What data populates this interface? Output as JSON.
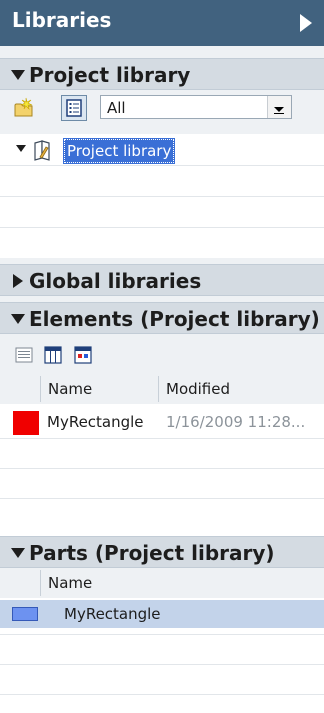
{
  "panel": {
    "title": "Libraries"
  },
  "project_library": {
    "header": "Project library",
    "filter": {
      "value": "All"
    },
    "tree": [
      {
        "label": "Project library",
        "selected": true
      }
    ]
  },
  "global_libraries": {
    "header": "Global libraries"
  },
  "elements": {
    "header": "Elements (Project library)",
    "columns": [
      "Name",
      "Modified"
    ],
    "rows": [
      {
        "name": "MyRectangle",
        "modified": "1/16/2009 11:28...",
        "color": "#f00000"
      }
    ]
  },
  "parts": {
    "header": "Parts (Project library)",
    "columns": [
      "Name"
    ],
    "rows": [
      {
        "name": "MyRectangle",
        "selected": true,
        "color": "#6d92f0"
      }
    ]
  },
  "colors": {
    "title_bar": "#41627f",
    "selection": "#3a6fd6",
    "row_highlight": "#c3d3ea"
  }
}
